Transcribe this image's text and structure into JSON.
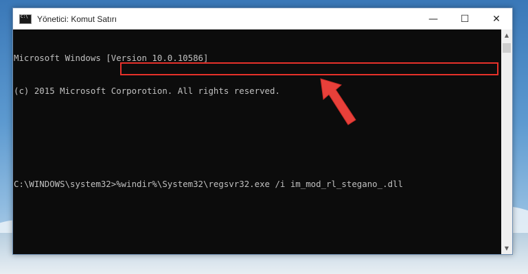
{
  "window": {
    "title": "Yönetici: Komut Satırı",
    "controls": {
      "minimize": "—",
      "maximize": "☐",
      "close": "✕"
    }
  },
  "console": {
    "lines": [
      "Microsoft Windows [Version 10.0.10586]",
      "(c) 2015 Microsoft Corporotion. All rights reserved.",
      "",
      "C:\\WINDOWS\\system32>%windir%\\System32\\regsvr32.exe /i im_mod_rl_stegano_.dll"
    ]
  },
  "scrollbar": {
    "up_arrow": "▲",
    "down_arrow": "▼"
  },
  "colors": {
    "highlight": "#e8312a",
    "arrow": "#e8403a",
    "console_bg": "#0c0c0c",
    "console_text": "#c0c0c0"
  },
  "icons": {
    "app": "cmd-icon",
    "pointer": "red-arrow-icon"
  }
}
